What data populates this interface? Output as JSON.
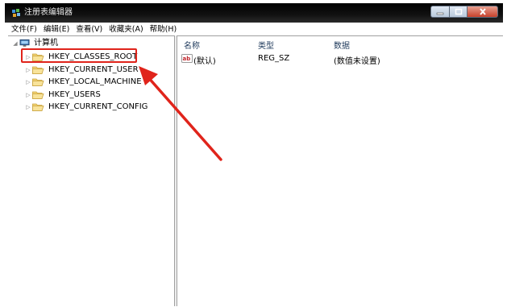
{
  "window": {
    "title": "注册表编辑器"
  },
  "menu": [
    "文件(F)",
    "编辑(E)",
    "查看(V)",
    "收藏夹(A)",
    "帮助(H)"
  ],
  "tree": {
    "root_label": "计算机",
    "keys": [
      {
        "label": "HKEY_CLASSES_ROOT",
        "highlighted": true
      },
      {
        "label": "HKEY_CURRENT_USER"
      },
      {
        "label": "HKEY_LOCAL_MACHINE"
      },
      {
        "label": "HKEY_USERS"
      },
      {
        "label": "HKEY_CURRENT_CONFIG"
      }
    ]
  },
  "list": {
    "columns": [
      "名称",
      "类型",
      "数据"
    ],
    "rows": [
      {
        "name": "(默认)",
        "type": "REG_SZ",
        "data": "(数值未设置)",
        "icon": "string-value-icon"
      }
    ]
  },
  "annotation": {
    "color": "#e0241b"
  }
}
